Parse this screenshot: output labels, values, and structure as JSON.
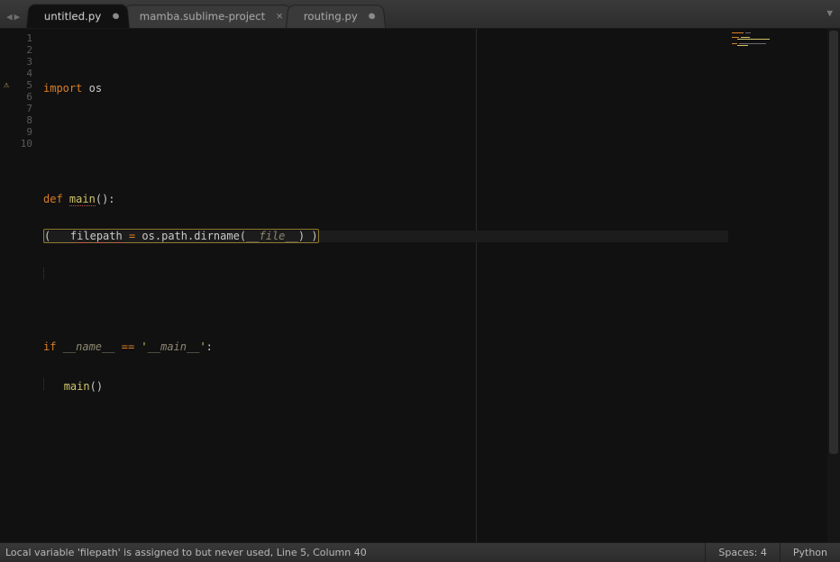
{
  "tabs": [
    {
      "title": "untitled.py",
      "dirty": true,
      "active": true
    },
    {
      "title": "mamba.sublime-project",
      "dirty": false,
      "active": false
    },
    {
      "title": "routing.py",
      "dirty": true,
      "active": false
    }
  ],
  "gutter": {
    "warning_line": 5,
    "warning_glyph": "⚠"
  },
  "line_count": 10,
  "code": {
    "l1": {
      "import": "import",
      "mod": "os"
    },
    "l4": {
      "def": "def",
      "fn": "main",
      "paren_open": "(",
      "paren_close": ")",
      "colon": ":"
    },
    "l5": {
      "indent_paren_open": "(",
      "var": "filepath",
      "eq": "=",
      "expr_os": "os",
      "dot1": ".",
      "expr_path": "path",
      "dot2": ".",
      "expr_dirname": "dirname",
      "po": "(",
      "file": "__file__",
      "pc": ")",
      "indent_paren_close": ")"
    },
    "l8": {
      "if": "if",
      "name": "__name__",
      "eqeq": "==",
      "q1": "'",
      "main": "__main__",
      "q2": "'",
      "colon": ":"
    },
    "l9": {
      "fn": "main",
      "po": "(",
      "pc": ")"
    }
  },
  "status": {
    "lint_msg": "Local variable 'filepath' is assigned to but never used, Line 5, Column 40",
    "indent": "Spaces: 4",
    "syntax": "Python"
  }
}
